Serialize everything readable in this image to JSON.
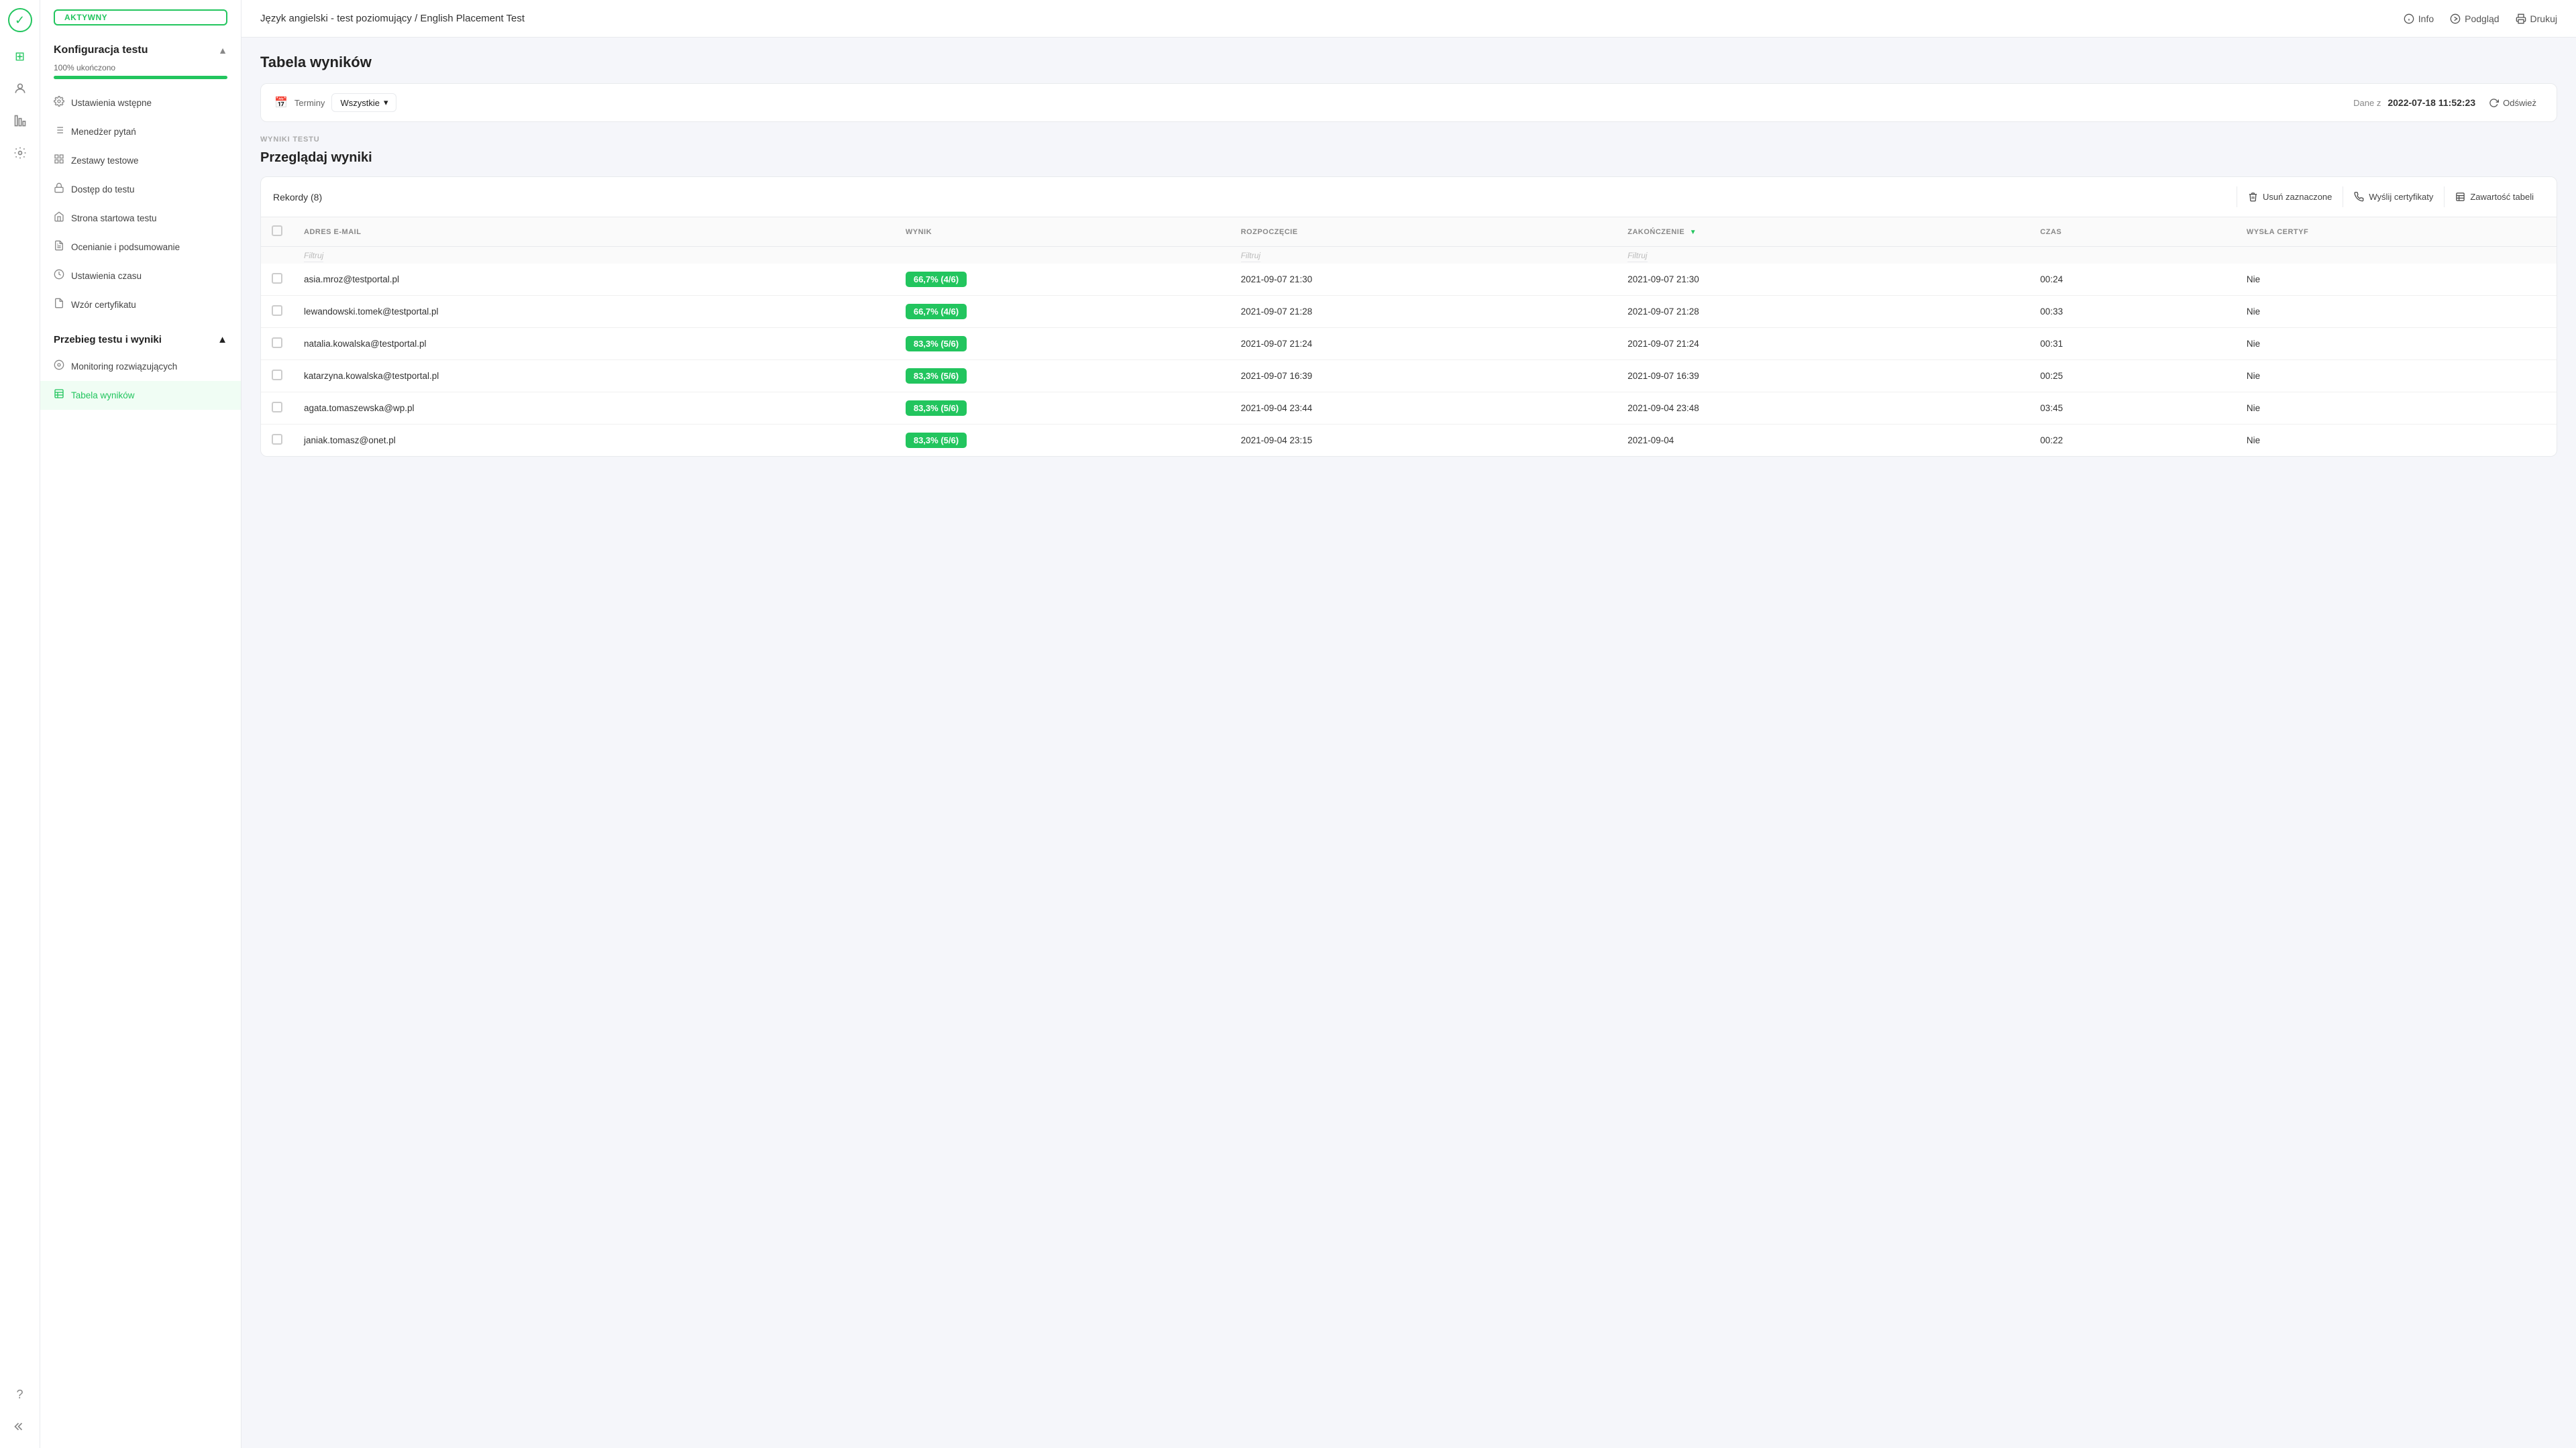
{
  "app": {
    "logo_icon": "✓",
    "title": "Język angielski - test poziomujący / English Placement Test"
  },
  "icon_bar": {
    "items": [
      {
        "name": "home-icon",
        "icon": "⊞",
        "active": false
      },
      {
        "name": "users-icon",
        "icon": "👤",
        "active": false
      },
      {
        "name": "analytics-icon",
        "icon": "📊",
        "active": false
      },
      {
        "name": "settings-icon",
        "icon": "⚙",
        "active": false
      },
      {
        "name": "help-icon",
        "icon": "?",
        "active": false
      },
      {
        "name": "back-icon",
        "icon": "←",
        "active": false
      }
    ]
  },
  "sidebar": {
    "active_badge": "AKTYWNY",
    "konfiguracja": {
      "heading": "Konfiguracja testu",
      "progress_label": "100% ukończono",
      "progress_value": 100,
      "items": [
        {
          "label": "Ustawienia wstępne",
          "icon": "⚙",
          "active": false
        },
        {
          "label": "Menedżer pytań",
          "icon": "≡",
          "active": false
        },
        {
          "label": "Zestawy testowe",
          "icon": "⊞",
          "active": false
        },
        {
          "label": "Dostęp do testu",
          "icon": "🔒",
          "active": false
        },
        {
          "label": "Strona startowa testu",
          "icon": "🏠",
          "active": false
        },
        {
          "label": "Ocenianie i podsumowanie",
          "icon": "📄",
          "active": false
        },
        {
          "label": "Ustawienia czasu",
          "icon": "⏱",
          "active": false
        },
        {
          "label": "Wzór certyfikatu",
          "icon": "📋",
          "active": false
        }
      ]
    },
    "przebieg": {
      "heading": "Przebieg testu i wyniki",
      "items": [
        {
          "label": "Monitoring rozwiązujących",
          "icon": "◎",
          "active": false
        },
        {
          "label": "Tabela wyników",
          "icon": "📊",
          "active": true
        }
      ]
    }
  },
  "topbar": {
    "info_label": "Info",
    "preview_label": "Podgląd",
    "print_label": "Drukuj"
  },
  "main": {
    "page_title": "Tabela wyników",
    "filter_bar": {
      "calendar_icon": "📅",
      "terminy_label": "Terminy",
      "wszystkie_label": "Wszystkie",
      "dane_z_label": "Dane z",
      "date_value": "2022-07-18 11:52:23",
      "refresh_label": "Odśwież"
    },
    "section_label": "WYNIKI TESTU",
    "results_heading": "Przeglądaj wyniki",
    "table": {
      "records_label": "Rekordy (8)",
      "delete_label": "Usuń zaznaczone",
      "send_cert_label": "Wyślij certyfikaty",
      "table_content_label": "Zawartość tabeli",
      "columns": [
        {
          "key": "email",
          "label": "ADRES E-MAIL"
        },
        {
          "key": "score",
          "label": "WYNIK"
        },
        {
          "key": "start",
          "label": "ROZPOCZĘCIE"
        },
        {
          "key": "end",
          "label": "ZAKOŃCZENIE",
          "sorted": true
        },
        {
          "key": "time",
          "label": "CZAS"
        },
        {
          "key": "cert",
          "label": "WYSŁA CERTYF"
        }
      ],
      "filter_placeholders": {
        "email": "Filtruj",
        "start": "Filtruj",
        "end": "Filtruj"
      },
      "rows": [
        {
          "email": "asia.mroz@testportal.pl",
          "score": "66,7% (4/6)",
          "score_color": "#22c55e",
          "start": "2021-09-07 21:30",
          "end": "2021-09-07 21:30",
          "time": "00:24",
          "cert": "Nie"
        },
        {
          "email": "lewandowski.tomek@testportal.pl",
          "score": "66,7% (4/6)",
          "score_color": "#22c55e",
          "start": "2021-09-07 21:28",
          "end": "2021-09-07 21:28",
          "time": "00:33",
          "cert": "Nie"
        },
        {
          "email": "natalia.kowalska@testportal.pl",
          "score": "83,3% (5/6)",
          "score_color": "#22c55e",
          "start": "2021-09-07 21:24",
          "end": "2021-09-07 21:24",
          "time": "00:31",
          "cert": "Nie"
        },
        {
          "email": "katarzyna.kowalska@testportal.pl",
          "score": "83,3% (5/6)",
          "score_color": "#22c55e",
          "start": "2021-09-07 16:39",
          "end": "2021-09-07 16:39",
          "time": "00:25",
          "cert": "Nie"
        },
        {
          "email": "agata.tomaszewska@wp.pl",
          "score": "83,3% (5/6)",
          "score_color": "#22c55e",
          "start": "2021-09-04 23:44",
          "end": "2021-09-04 23:48",
          "time": "03:45",
          "cert": "Nie"
        },
        {
          "email": "janiak.tomasz@onet.pl",
          "score": "83,3% (5/6)",
          "score_color": "#22c55e",
          "start": "2021-09-04 23:15",
          "end": "2021-09-04",
          "time": "00:22",
          "cert": "Nie"
        }
      ]
    }
  }
}
